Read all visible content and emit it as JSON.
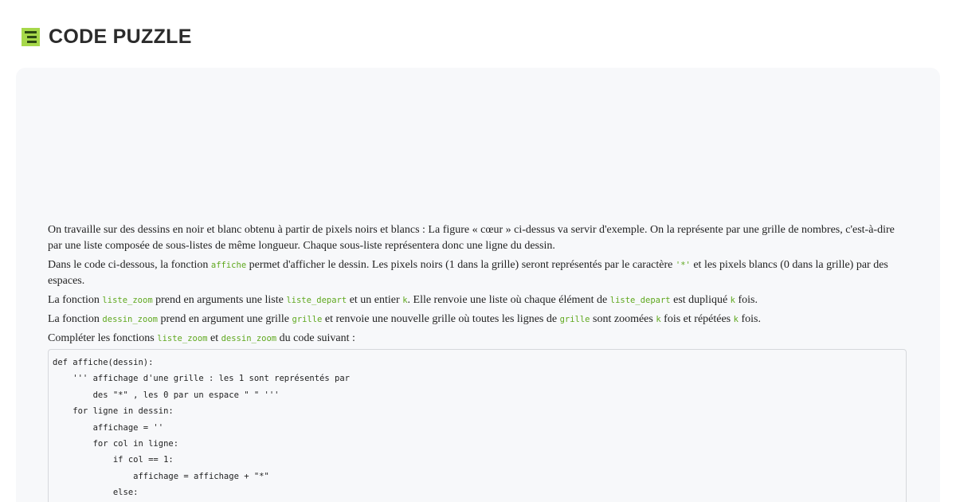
{
  "header": {
    "title": "CODE PUZZLE",
    "logo_icon": "code-puzzle-logo-icon",
    "logo_color": "#a6d84a"
  },
  "colors": {
    "accent": "#5fa81e",
    "panel_bg": "#f7f8fa"
  },
  "instructions": {
    "p1": "On travaille sur des dessins en noir et blanc obtenu à partir de pixels noirs et blancs : La figure « cœur » ci-dessus va servir d'exemple. On la représente par une grille de nombres, c'est-à-dire par une liste composée de sous-listes de même longueur. Chaque sous-liste représentera donc une ligne du dessin.",
    "p2": {
      "a": "Dans le code ci-dessous, la fonction ",
      "code1": "affiche",
      "b": " permet d'afficher le dessin. Les pixels noirs (1 dans la grille) seront représentés par le caractère ",
      "code2": "'*'",
      "c": " et les pixels blancs (0 dans la grille) par des espaces."
    },
    "p3": {
      "a": "La fonction ",
      "code1": "liste_zoom",
      "b": " prend en arguments une liste ",
      "code2": "liste_depart",
      "c": " et un entier ",
      "code3": "k",
      "d": ". Elle renvoie une liste où chaque élément de ",
      "code4": "liste_depart",
      "e": " est dupliqué ",
      "code5": "k",
      "f": " fois."
    },
    "p4": {
      "a": "La fonction ",
      "code1": "dessin_zoom",
      "b": " prend en argument une grille ",
      "code2": "grille",
      "c": " et renvoie une nouvelle grille où toutes les lignes de ",
      "code3": "grille",
      "d": " sont zoomées ",
      "code4": "k",
      "e": " fois et répétées ",
      "code5": "k",
      "f": " fois."
    },
    "p5": {
      "a": "Compléter les fonctions ",
      "code1": "liste_zoom",
      "b": " et ",
      "code2": "dessin_zoom",
      "c": " du code suivant :"
    }
  },
  "code": {
    "lines": [
      "def affiche(dessin):",
      "    ''' affichage d'une grille : les 1 sont représentés par",
      "        des \"*\" , les 0 par un espace \" \" '''",
      "    for ligne in dessin:",
      "        affichage = ''",
      "        for col in ligne:",
      "            if col == 1:",
      "                affichage = affichage + \"*\"",
      "            else:"
    ]
  }
}
